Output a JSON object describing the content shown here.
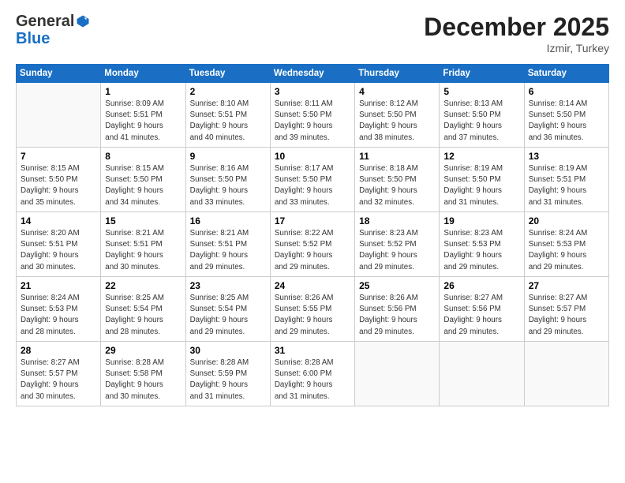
{
  "header": {
    "logo_line1": "General",
    "logo_line2": "Blue",
    "month": "December 2025",
    "location": "Izmir, Turkey"
  },
  "weekdays": [
    "Sunday",
    "Monday",
    "Tuesday",
    "Wednesday",
    "Thursday",
    "Friday",
    "Saturday"
  ],
  "weeks": [
    [
      {
        "day": "",
        "info": ""
      },
      {
        "day": "1",
        "info": "Sunrise: 8:09 AM\nSunset: 5:51 PM\nDaylight: 9 hours\nand 41 minutes."
      },
      {
        "day": "2",
        "info": "Sunrise: 8:10 AM\nSunset: 5:51 PM\nDaylight: 9 hours\nand 40 minutes."
      },
      {
        "day": "3",
        "info": "Sunrise: 8:11 AM\nSunset: 5:50 PM\nDaylight: 9 hours\nand 39 minutes."
      },
      {
        "day": "4",
        "info": "Sunrise: 8:12 AM\nSunset: 5:50 PM\nDaylight: 9 hours\nand 38 minutes."
      },
      {
        "day": "5",
        "info": "Sunrise: 8:13 AM\nSunset: 5:50 PM\nDaylight: 9 hours\nand 37 minutes."
      },
      {
        "day": "6",
        "info": "Sunrise: 8:14 AM\nSunset: 5:50 PM\nDaylight: 9 hours\nand 36 minutes."
      }
    ],
    [
      {
        "day": "7",
        "info": "Sunrise: 8:15 AM\nSunset: 5:50 PM\nDaylight: 9 hours\nand 35 minutes."
      },
      {
        "day": "8",
        "info": "Sunrise: 8:15 AM\nSunset: 5:50 PM\nDaylight: 9 hours\nand 34 minutes."
      },
      {
        "day": "9",
        "info": "Sunrise: 8:16 AM\nSunset: 5:50 PM\nDaylight: 9 hours\nand 33 minutes."
      },
      {
        "day": "10",
        "info": "Sunrise: 8:17 AM\nSunset: 5:50 PM\nDaylight: 9 hours\nand 33 minutes."
      },
      {
        "day": "11",
        "info": "Sunrise: 8:18 AM\nSunset: 5:50 PM\nDaylight: 9 hours\nand 32 minutes."
      },
      {
        "day": "12",
        "info": "Sunrise: 8:19 AM\nSunset: 5:50 PM\nDaylight: 9 hours\nand 31 minutes."
      },
      {
        "day": "13",
        "info": "Sunrise: 8:19 AM\nSunset: 5:51 PM\nDaylight: 9 hours\nand 31 minutes."
      }
    ],
    [
      {
        "day": "14",
        "info": "Sunrise: 8:20 AM\nSunset: 5:51 PM\nDaylight: 9 hours\nand 30 minutes."
      },
      {
        "day": "15",
        "info": "Sunrise: 8:21 AM\nSunset: 5:51 PM\nDaylight: 9 hours\nand 30 minutes."
      },
      {
        "day": "16",
        "info": "Sunrise: 8:21 AM\nSunset: 5:51 PM\nDaylight: 9 hours\nand 29 minutes."
      },
      {
        "day": "17",
        "info": "Sunrise: 8:22 AM\nSunset: 5:52 PM\nDaylight: 9 hours\nand 29 minutes."
      },
      {
        "day": "18",
        "info": "Sunrise: 8:23 AM\nSunset: 5:52 PM\nDaylight: 9 hours\nand 29 minutes."
      },
      {
        "day": "19",
        "info": "Sunrise: 8:23 AM\nSunset: 5:53 PM\nDaylight: 9 hours\nand 29 minutes."
      },
      {
        "day": "20",
        "info": "Sunrise: 8:24 AM\nSunset: 5:53 PM\nDaylight: 9 hours\nand 29 minutes."
      }
    ],
    [
      {
        "day": "21",
        "info": "Sunrise: 8:24 AM\nSunset: 5:53 PM\nDaylight: 9 hours\nand 28 minutes."
      },
      {
        "day": "22",
        "info": "Sunrise: 8:25 AM\nSunset: 5:54 PM\nDaylight: 9 hours\nand 28 minutes."
      },
      {
        "day": "23",
        "info": "Sunrise: 8:25 AM\nSunset: 5:54 PM\nDaylight: 9 hours\nand 29 minutes."
      },
      {
        "day": "24",
        "info": "Sunrise: 8:26 AM\nSunset: 5:55 PM\nDaylight: 9 hours\nand 29 minutes."
      },
      {
        "day": "25",
        "info": "Sunrise: 8:26 AM\nSunset: 5:56 PM\nDaylight: 9 hours\nand 29 minutes."
      },
      {
        "day": "26",
        "info": "Sunrise: 8:27 AM\nSunset: 5:56 PM\nDaylight: 9 hours\nand 29 minutes."
      },
      {
        "day": "27",
        "info": "Sunrise: 8:27 AM\nSunset: 5:57 PM\nDaylight: 9 hours\nand 29 minutes."
      }
    ],
    [
      {
        "day": "28",
        "info": "Sunrise: 8:27 AM\nSunset: 5:57 PM\nDaylight: 9 hours\nand 30 minutes."
      },
      {
        "day": "29",
        "info": "Sunrise: 8:28 AM\nSunset: 5:58 PM\nDaylight: 9 hours\nand 30 minutes."
      },
      {
        "day": "30",
        "info": "Sunrise: 8:28 AM\nSunset: 5:59 PM\nDaylight: 9 hours\nand 31 minutes."
      },
      {
        "day": "31",
        "info": "Sunrise: 8:28 AM\nSunset: 6:00 PM\nDaylight: 9 hours\nand 31 minutes."
      },
      {
        "day": "",
        "info": ""
      },
      {
        "day": "",
        "info": ""
      },
      {
        "day": "",
        "info": ""
      }
    ]
  ]
}
